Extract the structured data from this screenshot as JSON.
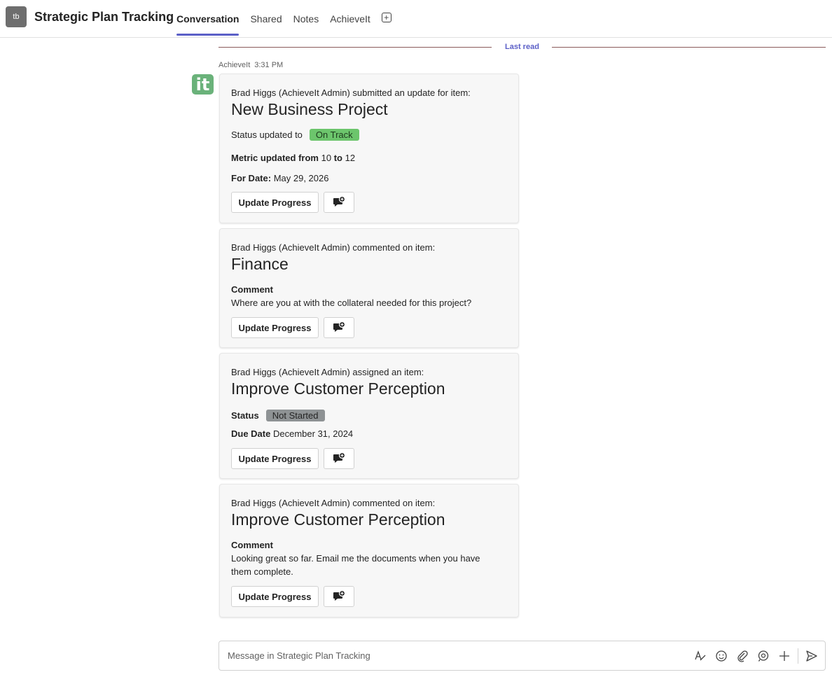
{
  "header": {
    "avatar_initials": "tb",
    "channel_title": "Strategic Plan Tracking",
    "tabs": [
      {
        "label": "Conversation",
        "active": true
      },
      {
        "label": "Shared",
        "active": false
      },
      {
        "label": "Notes",
        "active": false
      },
      {
        "label": "AchieveIt",
        "active": false
      }
    ],
    "add_tab_icon": "plus-square-icon"
  },
  "divider": {
    "label": "Last read"
  },
  "message": {
    "sender": "AchieveIt",
    "time": "3:31 PM",
    "avatar_text": "it",
    "avatar_color": "#6ab27a"
  },
  "cards": [
    {
      "intro": "Brad Higgs (AchieveIt Admin) submitted an update for item:",
      "title": "New Business Project",
      "status_label": "Status updated to",
      "status_value": "On Track",
      "metric_label": "Metric updated from",
      "metric_from": "10",
      "metric_to_word": "to",
      "metric_to": "12",
      "date_label": "For Date:",
      "date_value": "May 29, 2026",
      "button_label": "Update Progress"
    },
    {
      "intro": "Brad Higgs (AchieveIt Admin) commented on item:",
      "title": "Finance",
      "comment_label": "Comment",
      "comment_text": "Where are you at with the collateral needed for this project?",
      "button_label": "Update Progress"
    },
    {
      "intro": "Brad Higgs (AchieveIt Admin) assigned an item:",
      "title": "Improve Customer Perception",
      "status_label": "Status",
      "status_value": "Not Started",
      "due_label": "Due Date",
      "due_value": "December 31, 2024",
      "button_label": "Update Progress"
    },
    {
      "intro": "Brad Higgs (AchieveIt Admin) commented on item:",
      "title": "Improve Customer Perception",
      "comment_label": "Comment",
      "comment_line1": "Looking great so far. Email me the documents when you have",
      "comment_line2": "them complete.",
      "button_label": "Update Progress"
    }
  ],
  "compose": {
    "placeholder": "Message in Strategic Plan Tracking",
    "tools": [
      "format-icon",
      "emoji-icon",
      "attach-icon",
      "loop-icon",
      "plus-icon",
      "send-icon"
    ]
  },
  "colors": {
    "accent": "#5b5fc7",
    "on_track": "#6cc56c",
    "not_started": "#8e9294"
  }
}
